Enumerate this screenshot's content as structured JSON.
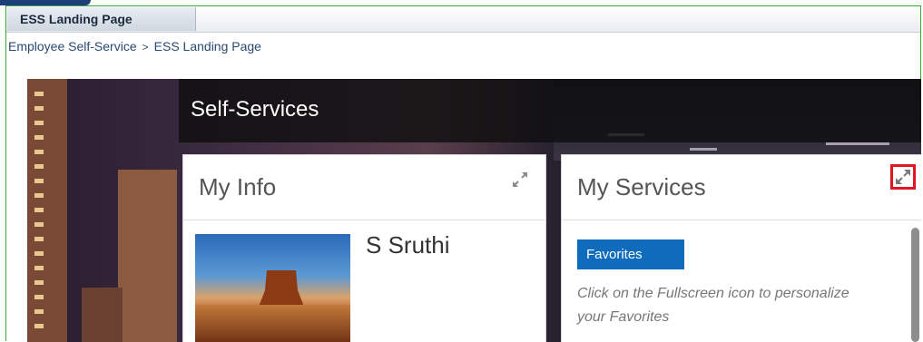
{
  "window": {
    "tab_label": "ESS Landing Page"
  },
  "breadcrumb": {
    "root": "Employee Self-Service",
    "separator": ">",
    "current": "ESS Landing Page"
  },
  "self_services": {
    "title": "Self-Services"
  },
  "my_info": {
    "title": "My Info",
    "user_name": "S Sruthi",
    "expand_icon": "fullscreen-icon"
  },
  "my_services": {
    "title": "My Services",
    "expand_icon": "fullscreen-icon",
    "favorites_label": "Favorites",
    "favorites_hint": "Click on the Fullscreen icon to personalize your Favorites"
  },
  "colors": {
    "frame_border": "#3aa43a",
    "favorites_button": "#0f6cbd",
    "highlight_box": "#e3161f"
  }
}
